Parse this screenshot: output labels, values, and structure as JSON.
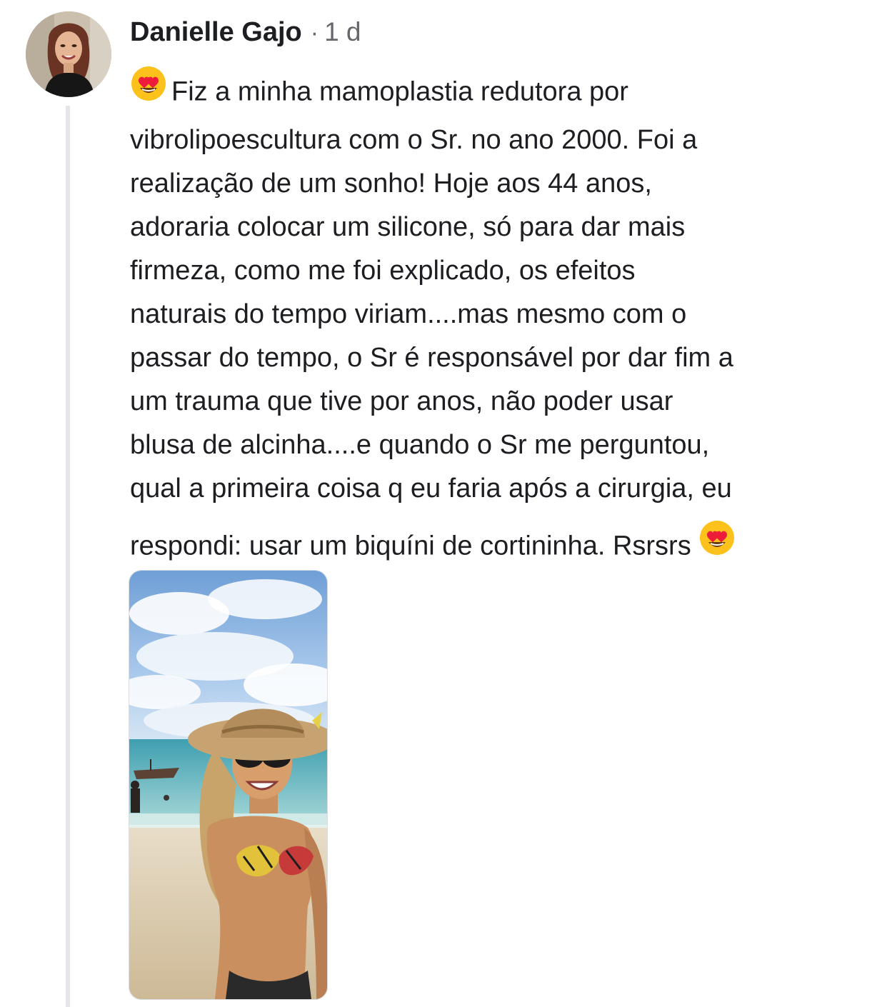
{
  "comment": {
    "author": {
      "name": "Danielle Gajo",
      "avatar_icon": "profile-photo-woman"
    },
    "separator": "·",
    "timestamp": "1 d",
    "text_lines": [
      "Fiz a minha mamoplastia redutora por",
      "vibrolipoescultura com o Sr. no ano 2000. Foi a",
      "realização de um sonho! Hoje aos 44 anos,",
      "adoraria colocar um silicone, só para dar mais",
      "firmeza, como me foi explicado, os efeitos",
      "naturais do tempo viriam....mas mesmo com o",
      "passar do tempo, o Sr é responsável por dar fim a",
      "um trauma que tive por anos, não poder usar",
      "blusa de alcinha....e quando o Sr me perguntou,",
      "qual a primeira coisa q eu faria após a cirurgia, eu",
      "respondi: usar um biquíni de cortininha. Rsrsrs"
    ],
    "emoji_icon": "heart-eyes-emoji",
    "attachment": {
      "type": "photo",
      "icon": "beach-photo"
    }
  },
  "colors": {
    "text": "#1c1e21",
    "secondary_text": "#65676b",
    "thread_line": "#e4e6eb",
    "emoji_face": "#fcc21b",
    "emoji_heart": "#ed1c3b"
  }
}
